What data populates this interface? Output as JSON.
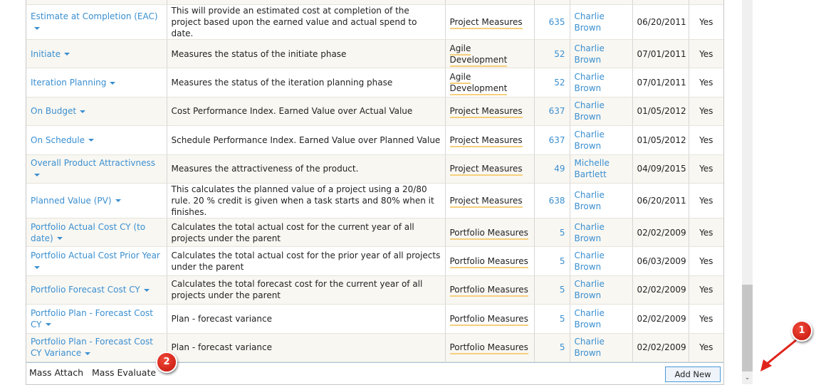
{
  "rows": [
    {
      "name": "Estimate at Completion (EAC)",
      "desc": "This will provide an estimated cost at completion of the project based upon the earned value and actual spend to date.",
      "category": "Project Measures",
      "count": "635",
      "owner": "Charlie Brown",
      "date": "06/20/2011",
      "active": "Yes"
    },
    {
      "name": "Initiate",
      "desc": "Measures the status of the initiate phase",
      "category": "Agile Development",
      "count": "52",
      "owner": "Charlie Brown",
      "date": "07/01/2011",
      "active": "Yes"
    },
    {
      "name": "Iteration Planning",
      "desc": "Measures the status of the iteration planning phase",
      "category": "Agile Development",
      "count": "52",
      "owner": "Charlie Brown",
      "date": "07/01/2011",
      "active": "Yes"
    },
    {
      "name": "On Budget",
      "desc": "Cost Performance Index. Earned Value over Actual Value",
      "category": "Project Measures",
      "count": "637",
      "owner": "Charlie Brown",
      "date": "01/05/2012",
      "active": "Yes"
    },
    {
      "name": "On Schedule",
      "desc": "Schedule Performance Index. Earned Value over Planned Value",
      "category": "Project Measures",
      "count": "637",
      "owner": "Charlie Brown",
      "date": "01/05/2012",
      "active": "Yes"
    },
    {
      "name": "Overall Product Attractivness",
      "desc": "Measures the attractiveness of the product.",
      "category": "Project Measures",
      "count": "49",
      "owner": "Michelle Bartlett",
      "date": "04/09/2015",
      "active": "Yes"
    },
    {
      "name": "Planned Value (PV)",
      "desc": "This calculates the planned value of a project using a 20/80 rule. 20 % credit is given when a task starts and 80% when it finishes.",
      "category": "Project Measures",
      "count": "638",
      "owner": "Charlie Brown",
      "date": "06/20/2011",
      "active": "Yes"
    },
    {
      "name": "Portfolio Actual Cost CY (to date)",
      "desc": "Calculates the total actual cost for the current year of all projects under the parent",
      "category": "Portfolio Measures",
      "count": "5",
      "owner": "Charlie Brown",
      "date": "02/02/2009",
      "active": "Yes"
    },
    {
      "name": "Portfolio Actual Cost Prior Year",
      "desc": "Calculates the total actual cost for the prior year of all projects under the parent",
      "category": "Portfolio Measures",
      "count": "5",
      "owner": "Charlie Brown",
      "date": "06/03/2009",
      "active": "Yes"
    },
    {
      "name": "Portfolio Forecast Cost CY",
      "desc": "Calculates the total forecast cost for the current year of all projects under the parent",
      "category": "Portfolio Measures",
      "count": "5",
      "owner": "Charlie Brown",
      "date": "02/02/2009",
      "active": "Yes"
    },
    {
      "name": "Portfolio Plan - Forecast Cost CY",
      "desc": "Plan - forecast variance",
      "category": "Portfolio Measures",
      "count": "5",
      "owner": "Charlie Brown",
      "date": "02/02/2009",
      "active": "Yes"
    },
    {
      "name": "Portfolio Plan - Forecast Cost CY Variance",
      "desc": "Plan - forecast variance",
      "category": "Portfolio Measures",
      "count": "5",
      "owner": "Charlie Brown",
      "date": "02/02/2009",
      "active": "Yes"
    }
  ],
  "footer": {
    "mass_attach": "Mass Attach",
    "mass_evaluate": "Mass Evaluate",
    "add_new": "Add New"
  },
  "annotations": {
    "badge1": "1",
    "badge2": "2"
  },
  "colors": {
    "link": "#3a8fd0",
    "badge": "#d41a10",
    "category_underline": "#f6cf7e"
  }
}
